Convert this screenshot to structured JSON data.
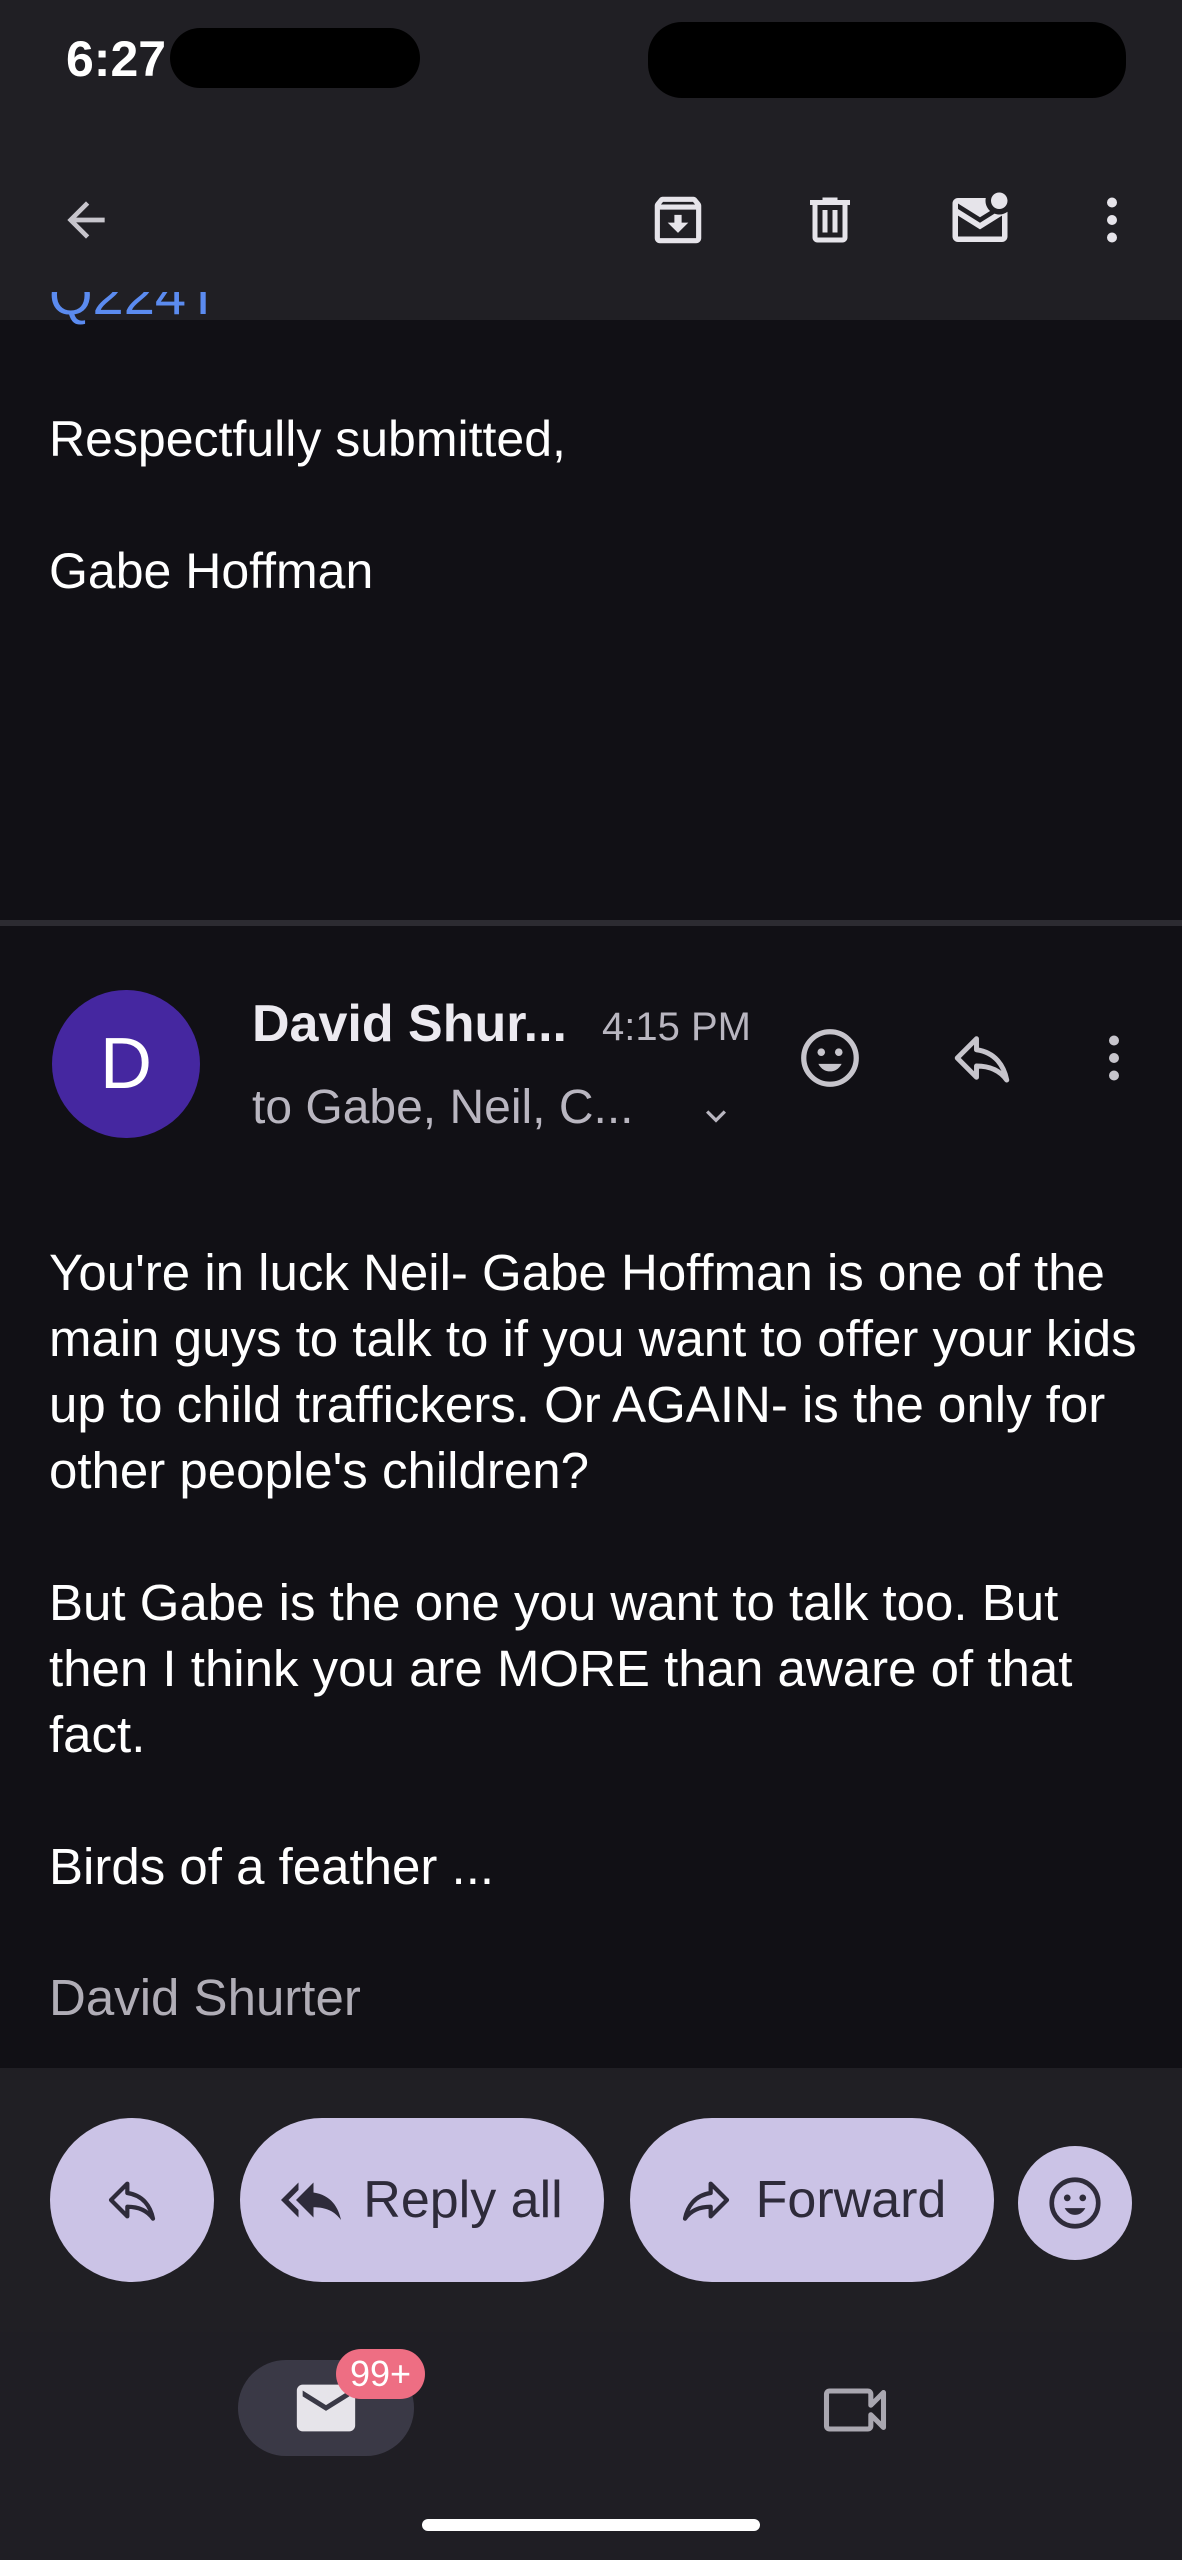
{
  "status_bar": {
    "time": "6:27"
  },
  "app_bar": {
    "icons": [
      "back-arrow-icon",
      "archive-icon",
      "delete-icon",
      "mark-unread-icon",
      "more-vert-icon"
    ]
  },
  "previous_message": {
    "closing": "Respectfully submitted,",
    "name": "Gabe Hoffman"
  },
  "message": {
    "avatar_letter": "D",
    "sender": "David Shur...",
    "time": "4:15 PM",
    "recipients": "to Gabe, Neil, C...",
    "paragraphs": [
      "You're in luck Neil- Gabe Hoffman is one of the main guys to talk to if you want to offer your kids up to child traffickers. Or AGAIN- is the only for other people's children?",
      "But Gabe is the one you want to talk too. But then I think you are MORE than aware of that fact.",
      "Birds of a feather ..."
    ],
    "signature": "David Shurter"
  },
  "actions": {
    "reply_all": "Reply all",
    "forward": "Forward"
  },
  "bottom_nav": {
    "mail_badge": "99+"
  },
  "colors": {
    "background": "#111015",
    "bar": "#201f24",
    "pill": "#cbc3e6",
    "avatar": "#4527a0",
    "badge": "#ee6e83",
    "link": "#5b8bf0"
  }
}
